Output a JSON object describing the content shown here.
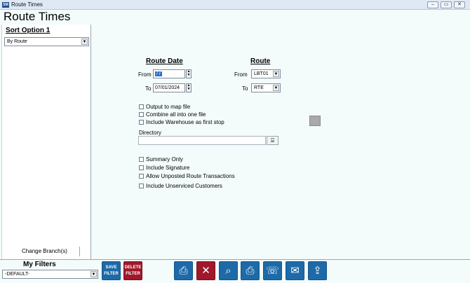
{
  "window": {
    "title": "Route Times",
    "logo": "SM",
    "buttons": {
      "minimize": "–",
      "restore": "▭",
      "close": "✕"
    }
  },
  "app_title": "Route Times",
  "sort": {
    "label": "Sort Option 1",
    "selected": "By Route"
  },
  "left_panel": {
    "change_branch_label": "Change Branch(s)"
  },
  "filters": {
    "label": "My Filters",
    "selected": "-DEFAULT-",
    "save_label": "SAVE FILTER",
    "delete_label": "DELETE FILTER"
  },
  "route_date": {
    "header": "Route Date",
    "from_label": "From",
    "from_value": "/ /",
    "to_label": "To",
    "to_value": "07/01/2024"
  },
  "route": {
    "header": "Route",
    "from_label": "From",
    "from_value": "LBT01",
    "to_label": "To",
    "to_value": "RTE"
  },
  "options_top": [
    {
      "label": "Output to map file",
      "checked": false
    },
    {
      "label": "Combine all into one file",
      "checked": false
    },
    {
      "label": "Include Warehouse as first stop",
      "checked": false
    }
  ],
  "directory": {
    "label": "Directory",
    "value": ""
  },
  "options_bottom": [
    {
      "label": "Summary Only",
      "checked": false
    },
    {
      "label": "Include Signature",
      "checked": false
    },
    {
      "label": "Allow Unposted Route Transactions",
      "checked": false
    },
    {
      "label": "Include Unserviced Customers",
      "checked": false
    }
  ],
  "toolbar": {
    "icons": [
      "print-icon",
      "cancel-icon",
      "search-icon",
      "print-preview-icon",
      "fax-icon",
      "email-icon",
      "export-icon"
    ],
    "accent_blue": "#1e6aa8",
    "accent_red": "#a0182a"
  }
}
